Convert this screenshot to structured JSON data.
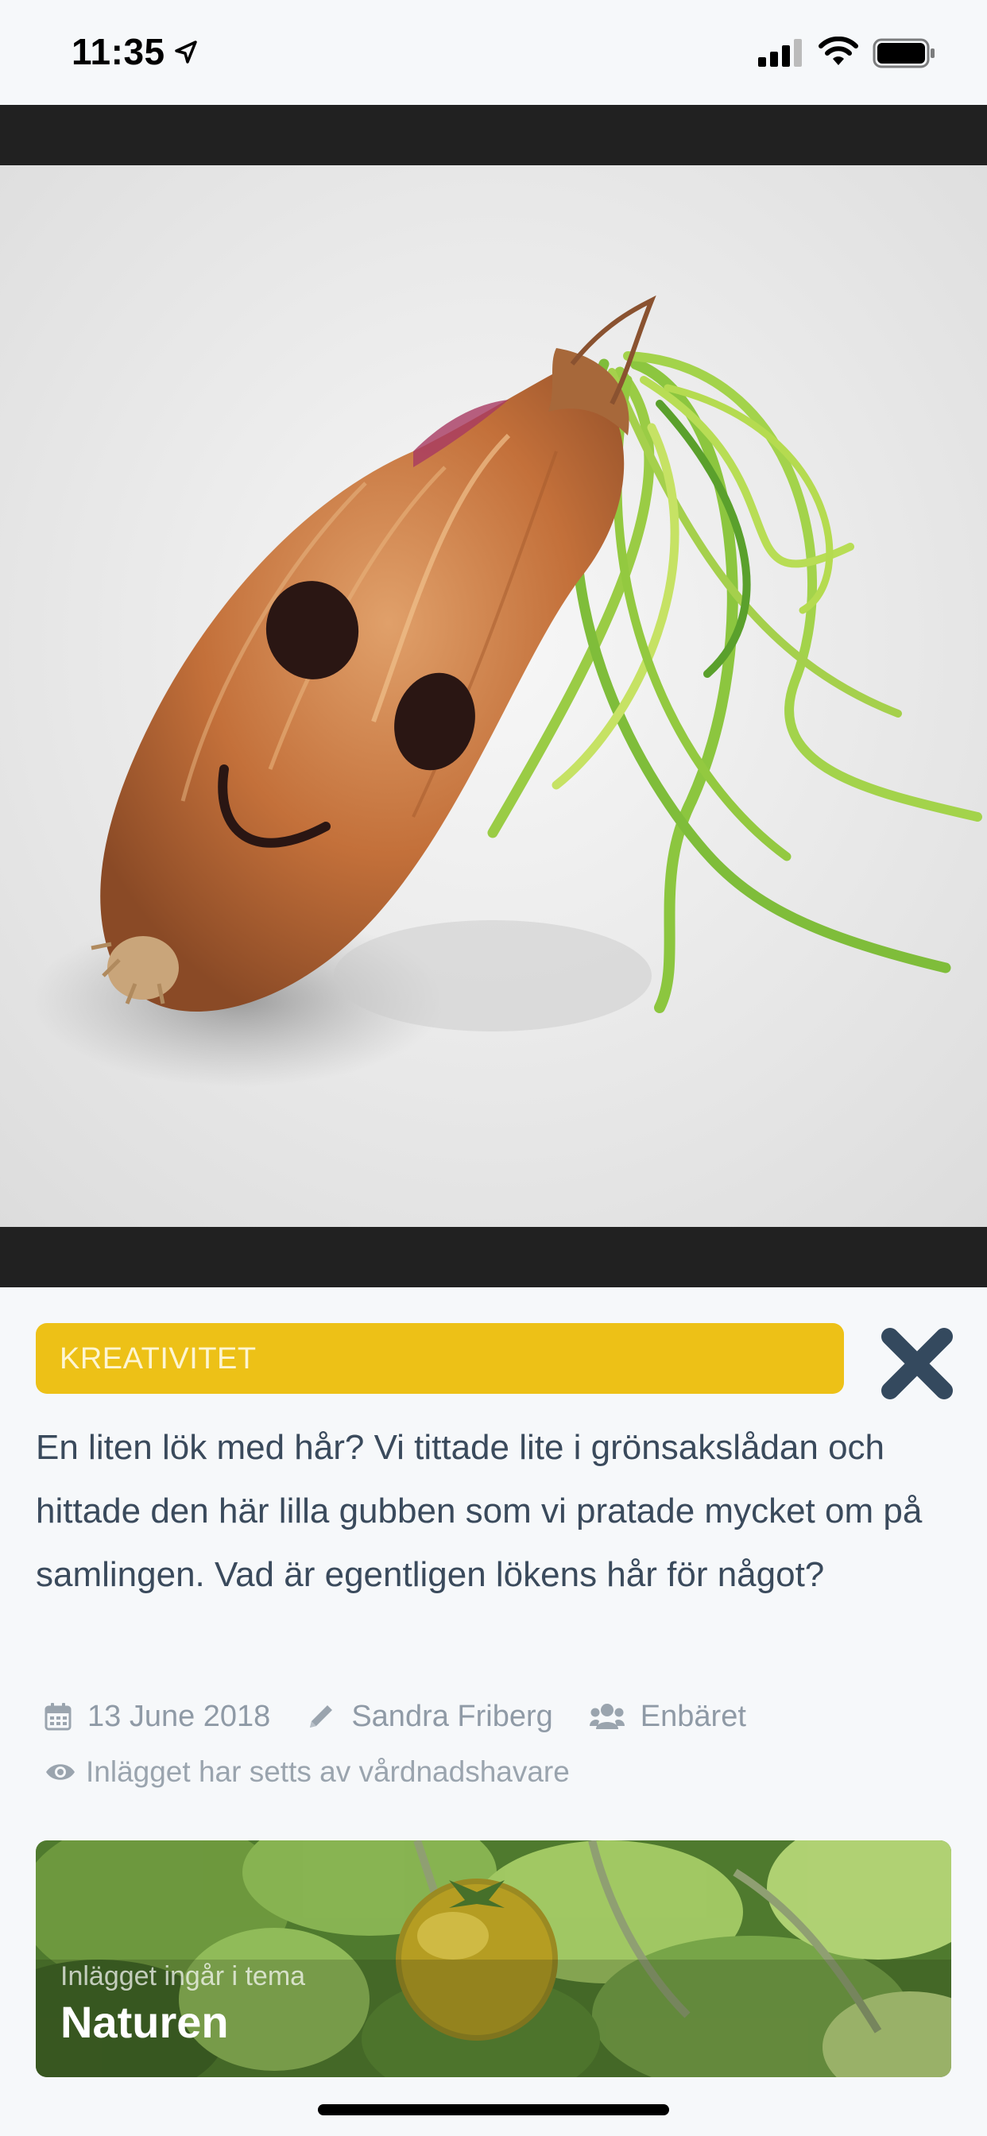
{
  "status_bar": {
    "time": "11:35"
  },
  "post": {
    "category": "KREATIVITET",
    "text": "En liten lök med hår? Vi tittade lite i grönsakslådan och hittade den här lilla gubben som vi pratade mycket om på samlingen. Vad är egentligen lökens hår för något?",
    "date": "13 June 2018",
    "author": "Sandra Friberg",
    "group": "Enbäret",
    "seen_status": "Inlägget har setts av vårdnadshavare"
  },
  "theme": {
    "subtitle": "Inlägget ingår i tema",
    "title": "Naturen"
  },
  "colors": {
    "category_bg": "#edc117",
    "text": "#3a4a5c",
    "meta": "#8f9aa6",
    "close_icon": "#34495e",
    "media_bg": "#212121"
  },
  "icons": {
    "close": "close-icon",
    "date": "calendar-icon",
    "author": "pencil-icon",
    "group": "users-icon",
    "seen": "eye-icon"
  }
}
